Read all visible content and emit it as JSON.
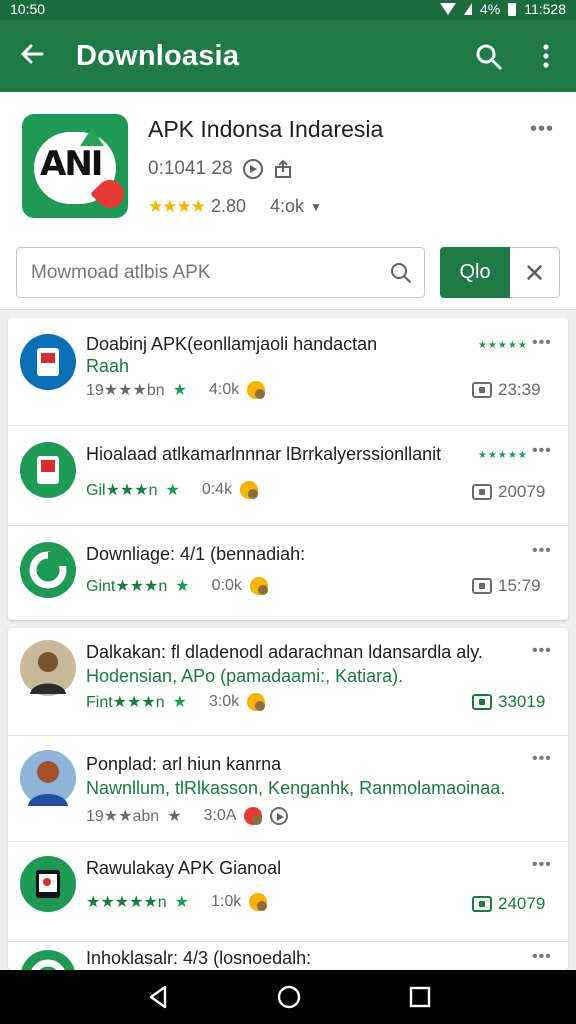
{
  "status": {
    "time": "10:50",
    "battery": "4%",
    "clock": "11:528"
  },
  "appbar": {
    "title": "Downloasia"
  },
  "app": {
    "name": "APK Indonsa Indaresia",
    "meta": "0:1041 28",
    "rating_value": "2.80",
    "rating_stars": "★★★★",
    "age": "4:ok"
  },
  "search": {
    "placeholder": "Mowmoad atlbis APK",
    "go_label": "Qlo",
    "clear_label": "✕"
  },
  "list": [
    {
      "title": "Doabinj APK(eonllamjaoli handactan",
      "subtitle": "Raah",
      "meta_prefix": "19★★★bn",
      "meta_value": "4:0k",
      "size": "23:39"
    },
    {
      "title": "Hioalaad atlkamarlnnnar lBrrkalyerssionllanit",
      "subtitle": "",
      "meta_prefix": "Gil★★★n",
      "meta_value": "0:4k",
      "size": "20079"
    },
    {
      "title": "Downliage: 4/1 (bennadiah:",
      "subtitle": "",
      "meta_prefix": "Gint★★★n",
      "meta_value": "0:0k",
      "size": "15:79"
    },
    {
      "title": "Dalkakan: fl dladenodl adarachnan ldansardla aly.",
      "subtitle": "Hodensian, APo (pamadaami:, Katiara).",
      "meta_prefix": "Fint★★★n",
      "meta_value": "3:0k",
      "size": "33019"
    },
    {
      "title": "Ponplad: arl hiun kanrna",
      "subtitle": "Nawnllum, tlRlkasson, Kenganhk, Ranmolamaoinaa.",
      "meta_prefix": "19★★abn",
      "meta_value": "3:0A",
      "size": ""
    },
    {
      "title": "Rawulakay APK Gianoal",
      "subtitle": "",
      "meta_prefix": "★★★★★n",
      "meta_value": "1:0k",
      "size": "24079"
    },
    {
      "title": "Inhoklasalr: 4/3 (losnoedalh:",
      "subtitle": "",
      "meta_prefix": "",
      "meta_value": "",
      "size": ""
    }
  ],
  "colors": {
    "primary": "#1f7a45",
    "status_bar": "#1c6b3d",
    "accent_green": "#1a7a3f",
    "star": "#f4b400"
  }
}
